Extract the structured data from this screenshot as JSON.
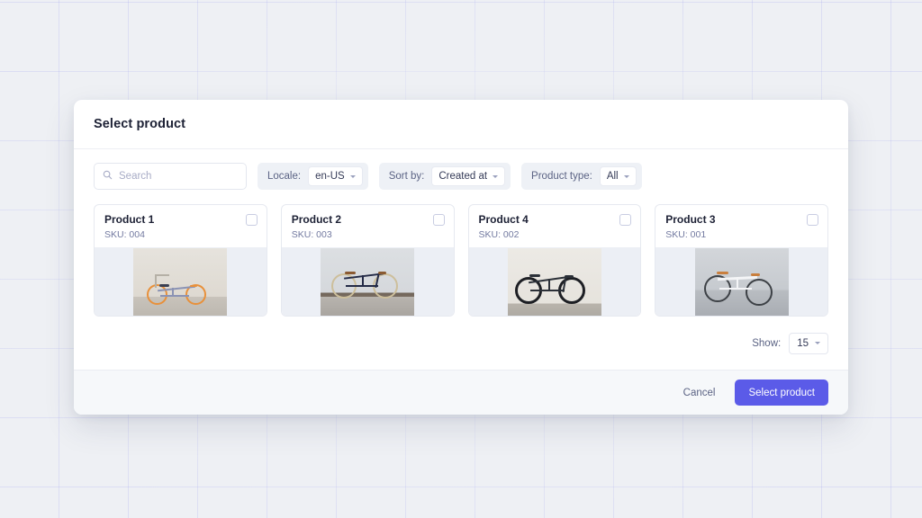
{
  "background": {
    "color": "#eef0f4",
    "grid_line_color": "#969bf0"
  },
  "modal": {
    "title": "Select product",
    "accent_color": "#5b5be8",
    "toolbar": {
      "search": {
        "placeholder": "Search",
        "value": "",
        "icon": "search-icon"
      },
      "filters": [
        {
          "label": "Locale:",
          "value": "en-US"
        },
        {
          "label": "Sort by:",
          "value": "Created at"
        },
        {
          "label": "Product type:",
          "value": "All"
        }
      ]
    },
    "products": [
      {
        "title": "Product 1",
        "sku": "SKU: 004",
        "checked": false,
        "image": "bicycle-orange-wheels-white-wall"
      },
      {
        "title": "Product 2",
        "sku": "SKU: 003",
        "checked": false,
        "image": "bicycle-navy-frame-cobblestone"
      },
      {
        "title": "Product 4",
        "sku": "SKU: 002",
        "checked": false,
        "image": "bicycle-black-frame-pale-wall"
      },
      {
        "title": "Product 3",
        "sku": "SKU: 001",
        "checked": false,
        "image": "bicycle-white-frame-gray-room"
      }
    ],
    "pagination": {
      "show_label": "Show:",
      "show_value": "15"
    },
    "footer": {
      "cancel_label": "Cancel",
      "submit_label": "Select product"
    }
  }
}
